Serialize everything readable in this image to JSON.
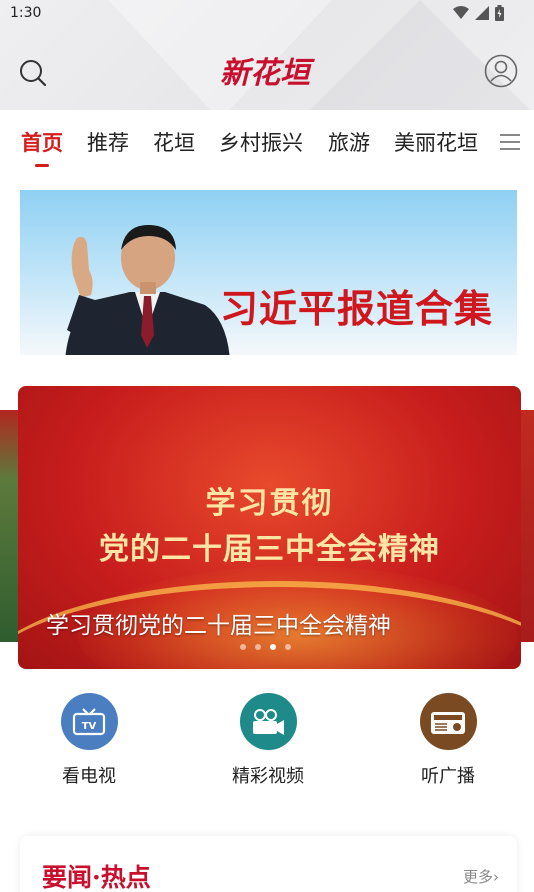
{
  "status_bar": {
    "time": "1:30"
  },
  "header": {
    "logo": "新花垣",
    "search_icon": "search-icon",
    "user_icon": "user-icon"
  },
  "tabs": [
    {
      "label": "首页",
      "active": true
    },
    {
      "label": "推荐"
    },
    {
      "label": "花垣"
    },
    {
      "label": "乡村振兴"
    },
    {
      "label": "旅游"
    },
    {
      "label": "美丽花垣"
    }
  ],
  "banner": {
    "title": "习近平报道合集"
  },
  "carousel": {
    "headline_line1": "学习贯彻",
    "headline_line2": "党的二十届三中全会精神",
    "caption": "学习贯彻党的二十届三中全会精神",
    "slide_count": 4,
    "active_index": 2
  },
  "quick_links": [
    {
      "label": "看电视",
      "icon": "tv-icon",
      "color": "#4a7ec0"
    },
    {
      "label": "精彩视频",
      "icon": "video-camera-icon",
      "color": "#1e8a8a"
    },
    {
      "label": "听广播",
      "icon": "radio-icon",
      "color": "#7a4a22"
    }
  ],
  "news_section": {
    "title": "要闻·热点",
    "more": "更多"
  },
  "colors": {
    "accent": "#d41c1c",
    "brand": "#c8102e"
  }
}
